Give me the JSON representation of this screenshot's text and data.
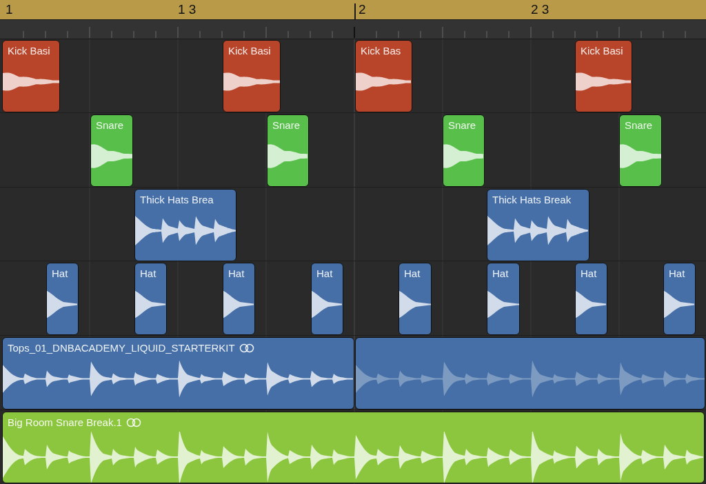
{
  "ruler": {
    "markers": [
      {
        "label": "1"
      },
      {
        "label": "1 3"
      },
      {
        "label": "2"
      },
      {
        "label": "2 3"
      }
    ]
  },
  "tracks": [
    {
      "regions": [
        {
          "kind": "region",
          "label": "Kick Basi",
          "color": "#b8452a",
          "loop_icon": false
        },
        {
          "kind": "region",
          "label": "Kick Basi",
          "color": "#b8452a",
          "loop_icon": false
        },
        {
          "kind": "region",
          "label": "Kick Bas",
          "color": "#b8452a",
          "loop_icon": false
        },
        {
          "kind": "region",
          "label": "Kick Basi",
          "color": "#b8452a",
          "loop_icon": false
        }
      ]
    },
    {
      "regions": [
        {
          "kind": "region",
          "label": "Snare",
          "color": "#58c04a",
          "loop_icon": false
        },
        {
          "kind": "region",
          "label": "Snare",
          "color": "#58c04a",
          "loop_icon": false
        },
        {
          "kind": "region",
          "label": "Snare",
          "color": "#58c04a",
          "loop_icon": false
        },
        {
          "kind": "region",
          "label": "Snare",
          "color": "#58c04a",
          "loop_icon": false
        }
      ]
    },
    {
      "regions": [
        {
          "kind": "region",
          "label": "Thick Hats Brea",
          "color": "#456fa6",
          "loop_icon": false
        },
        {
          "kind": "region",
          "label": "Thick Hats Break",
          "color": "#456fa6",
          "loop_icon": false
        }
      ]
    },
    {
      "regions": [
        {
          "kind": "region",
          "label": "Hat",
          "color": "#456fa6",
          "loop_icon": false
        },
        {
          "kind": "region",
          "label": "Hat",
          "color": "#456fa6",
          "loop_icon": false
        },
        {
          "kind": "region",
          "label": "Hat",
          "color": "#456fa6",
          "loop_icon": false
        },
        {
          "kind": "region",
          "label": "Hat",
          "color": "#456fa6",
          "loop_icon": false
        },
        {
          "kind": "region",
          "label": "Hat",
          "color": "#456fa6",
          "loop_icon": false
        },
        {
          "kind": "region",
          "label": "Hat",
          "color": "#456fa6",
          "loop_icon": false
        },
        {
          "kind": "region",
          "label": "Hat",
          "color": "#456fa6",
          "loop_icon": false
        },
        {
          "kind": "region",
          "label": "Hat",
          "color": "#456fa6",
          "loop_icon": false
        }
      ]
    },
    {
      "regions": [
        {
          "kind": "region",
          "label": "Tops_01_DNBACADEMY_LIQUID_STARTERKIT",
          "color": "#456fa6",
          "loop_icon": true
        },
        {
          "kind": "loop",
          "color": "#456fa6"
        }
      ]
    },
    {
      "regions": [
        {
          "kind": "region",
          "label": "Big Room Snare Break.1",
          "color": "#8cc63f",
          "loop_icon": true
        }
      ]
    }
  ]
}
